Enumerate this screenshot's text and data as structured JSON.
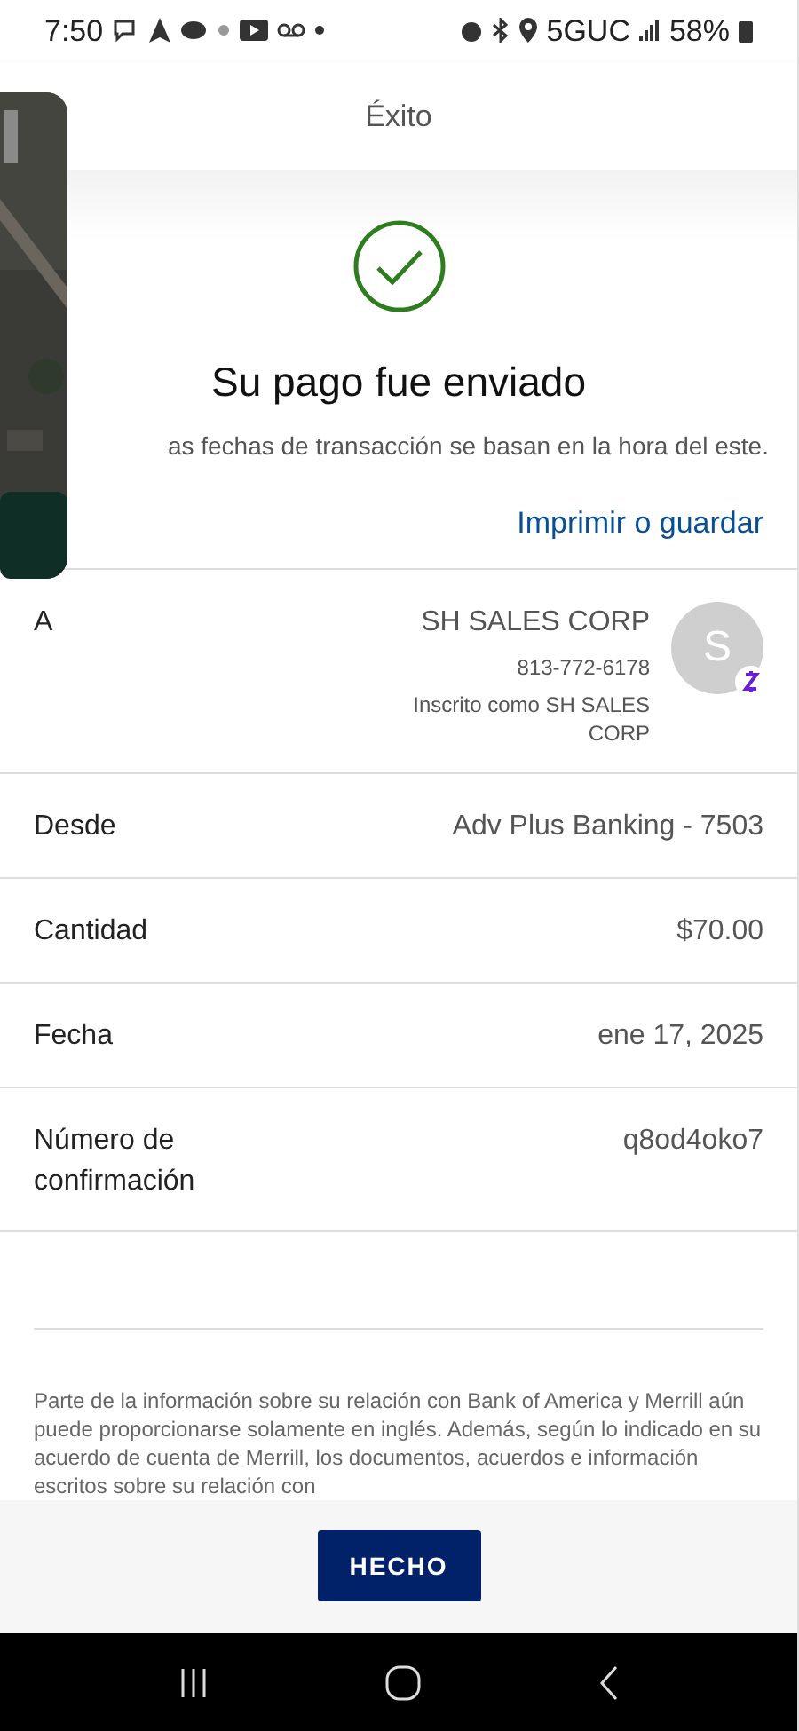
{
  "status_bar": {
    "time": "7:50",
    "network": "5GUC",
    "battery": "58%"
  },
  "header": {
    "title": "Éxito"
  },
  "confirmation": {
    "title": "Su pago fue enviado",
    "subtitle": "as fechas de transacción se basan en la hora del este.",
    "link": "Imprimir o guardar"
  },
  "details": [
    {
      "kind": "recipient",
      "label": "A",
      "name": "SH SALES CORP",
      "phone": "813-772-6178",
      "enrolled": "Inscrito como SH SALES CORP",
      "avatar": "S"
    },
    {
      "kind": "plain",
      "label": "Desde",
      "value": "Adv Plus Banking - 7503"
    },
    {
      "kind": "plain",
      "label": "Cantidad",
      "value": "$70.00"
    },
    {
      "kind": "plain",
      "label": "Fecha",
      "value": "ene 17, 2025"
    },
    {
      "kind": "plain",
      "label": "Número de confirmación",
      "value": "q8od4oko7"
    }
  ],
  "disclaimer": "Parte de la información sobre su relación con Bank of America y Merrill aún puede proporcionarse solamente en inglés. Además, según lo indicado en su acuerdo de cuenta de Merrill, los documentos, acuerdos e información escritos sobre su relación con",
  "footer": {
    "button": "HECHO"
  }
}
